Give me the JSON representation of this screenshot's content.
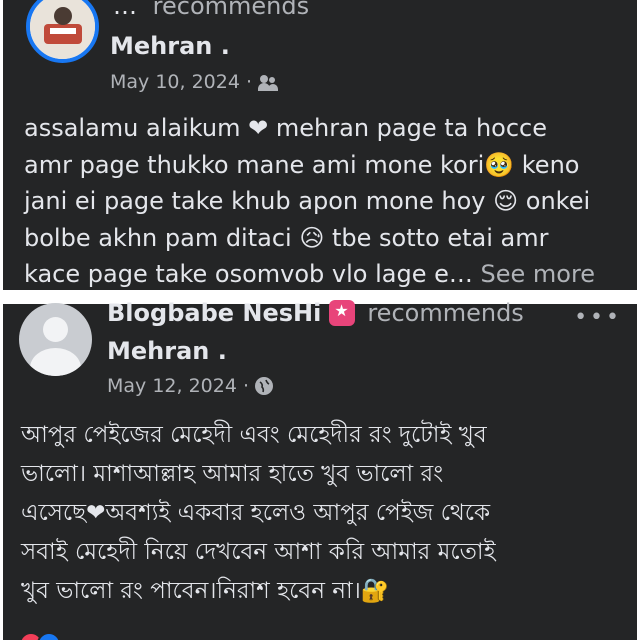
{
  "top_post": {
    "header_cut_text": "…",
    "recommends_label": "recommends",
    "page_name": "Mehran .",
    "date": "May 10, 2024 ·",
    "audience_icon": "friends-icon",
    "lines": [
      "assalamu alaikum ❤ mehran page ta hocce",
      "amr page thukko mane ami mone kori🥹 keno",
      "jani ei page take khub apon mone hoy 😌 onkei",
      "bolbe akhn pam ditaci 😥 tbe sotto etai amr"
    ],
    "last_line": "kace page take osomvob vlo lage e…",
    "see_more": "See more"
  },
  "bottom_post": {
    "recommender_name": "Blogbabe NesHi",
    "recommends_label": "recommends",
    "more_menu": "•••",
    "page_name": "Mehran .",
    "date": "May 12, 2024 ·",
    "audience_icon": "globe-icon",
    "lines": [
      "আপুর পেইজের মেহেদী এবং মেহেদীর রং দুটোই খুব",
      "ভালো। মাশাআল্লাহ আমার হাতে খুব ভালো রং",
      "এসেছে❤অবশ্যই একবার হলেও আপুর পেইজ থেকে",
      "সবাই মেহেদী নিয়ে দেখবেন আশা করি আমার মতোই",
      "খুব ভালো রং পাবেন।নিরাশ হবেন না।🔐"
    ]
  },
  "colors": {
    "card_bg": "#242526",
    "primary_text": "#e4e6eb",
    "secondary_text": "#b0b3b8",
    "accent_blue": "#1877f2",
    "heart_red": "#e41e3f"
  }
}
